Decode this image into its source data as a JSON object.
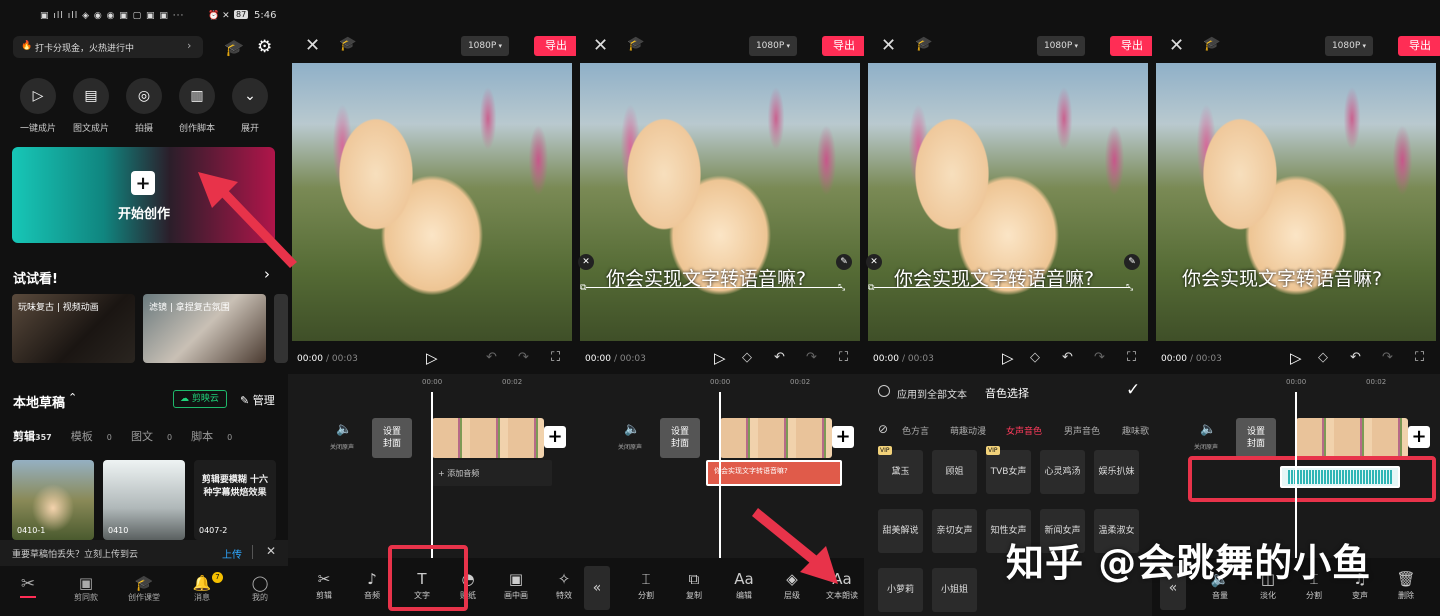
{
  "status": {
    "time": "5:46",
    "battery": "87"
  },
  "home": {
    "promo": "打卡分现金，火热进行中",
    "quick": [
      "一键成片",
      "图文成片",
      "拍摄",
      "创作脚本",
      "展开"
    ],
    "create_label": "开始创作",
    "try_title": "试试看!",
    "templates": [
      "玩味复古 | 视频动画",
      "滤镜 | 拿捏复古氛围"
    ],
    "drafts_title": "本地草稿",
    "cloud_label": "剪映云",
    "manage_label": "管理",
    "tabs": [
      {
        "label": "剪辑",
        "count": "357"
      },
      {
        "label": "模板",
        "count": "0"
      },
      {
        "label": "图文",
        "count": "0"
      },
      {
        "label": "脚本",
        "count": "0"
      }
    ],
    "drafts": [
      {
        "label": "0410-1",
        "thumb_text": ""
      },
      {
        "label": "0410",
        "thumb_text": ""
      },
      {
        "label": "0407-2",
        "thumb_text": "剪辑要模糊 十六种字幕烘焙效果"
      }
    ],
    "notice": "重要草稿怕丢失？立刻上传到云",
    "upload_label": "上传",
    "nav": [
      "剪同款",
      "创作课堂",
      "消息",
      "我的"
    ],
    "msg_badge": "7"
  },
  "editor": {
    "resolution": "1080P",
    "export_label": "导出",
    "time_current": "00:00",
    "time_total": "/ 00:03",
    "ruler": [
      "00:00",
      "00:02"
    ],
    "mute_label": "关闭原声",
    "cover_label": "设置\n封面",
    "add_audio": "+ 添加音频",
    "caption": "你会实现文字转语音嘛?",
    "text_clip": "你会实现文字转语音嘛?",
    "tools_p2": [
      "剪辑",
      "音频",
      "文字",
      "贴纸",
      "画中画",
      "特效"
    ],
    "tools_p3": [
      "分割",
      "复制",
      "编辑",
      "层级",
      "文本朗读"
    ],
    "tools_p5": [
      "音量",
      "淡化",
      "分割",
      "变声",
      "删除"
    ]
  },
  "voice_panel": {
    "apply_all": "应用到全部文本",
    "title": "音色选择",
    "categories": [
      "色方言",
      "萌趣动漫",
      "女声音色",
      "男声音色",
      "趣味歌"
    ],
    "active_category": "女声音色",
    "voices": [
      "黛玉",
      "顾姐",
      "TVB女声",
      "心灵鸡汤",
      "娱乐扒妹",
      "甜美解说",
      "亲切女声",
      "知性女声",
      "新闻女声",
      "温柔淑女",
      "小萝莉",
      "小姐姐"
    ],
    "vip": [
      "黛玉",
      "TVB女声"
    ],
    "vip_label": "VIP"
  },
  "watermark": "知乎 @会跳舞的小鱼",
  "colors": {
    "accent": "#ff2d55",
    "annotation": "#e8334a",
    "text_clip": "#e05b4a",
    "waveform": "#2fb5b5"
  }
}
